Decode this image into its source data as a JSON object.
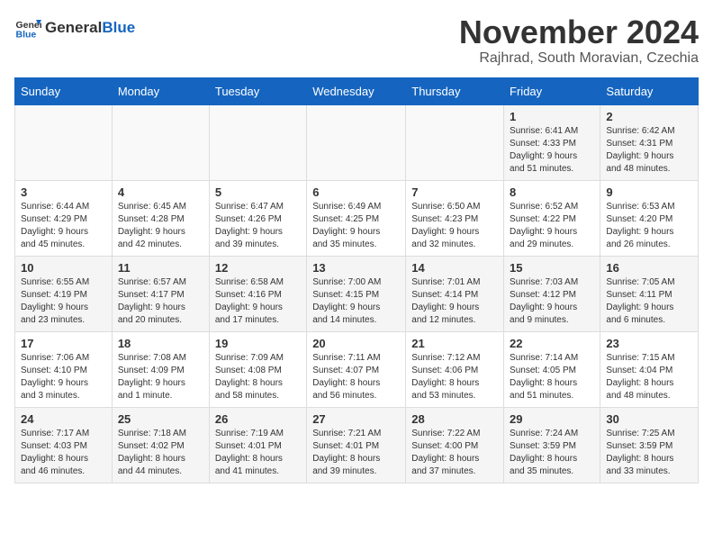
{
  "logo": {
    "general": "General",
    "blue": "Blue"
  },
  "header": {
    "month": "November 2024",
    "location": "Rajhrad, South Moravian, Czechia"
  },
  "weekdays": [
    "Sunday",
    "Monday",
    "Tuesday",
    "Wednesday",
    "Thursday",
    "Friday",
    "Saturday"
  ],
  "weeks": [
    [
      {
        "day": "",
        "info": ""
      },
      {
        "day": "",
        "info": ""
      },
      {
        "day": "",
        "info": ""
      },
      {
        "day": "",
        "info": ""
      },
      {
        "day": "",
        "info": ""
      },
      {
        "day": "1",
        "info": "Sunrise: 6:41 AM\nSunset: 4:33 PM\nDaylight: 9 hours\nand 51 minutes."
      },
      {
        "day": "2",
        "info": "Sunrise: 6:42 AM\nSunset: 4:31 PM\nDaylight: 9 hours\nand 48 minutes."
      }
    ],
    [
      {
        "day": "3",
        "info": "Sunrise: 6:44 AM\nSunset: 4:29 PM\nDaylight: 9 hours\nand 45 minutes."
      },
      {
        "day": "4",
        "info": "Sunrise: 6:45 AM\nSunset: 4:28 PM\nDaylight: 9 hours\nand 42 minutes."
      },
      {
        "day": "5",
        "info": "Sunrise: 6:47 AM\nSunset: 4:26 PM\nDaylight: 9 hours\nand 39 minutes."
      },
      {
        "day": "6",
        "info": "Sunrise: 6:49 AM\nSunset: 4:25 PM\nDaylight: 9 hours\nand 35 minutes."
      },
      {
        "day": "7",
        "info": "Sunrise: 6:50 AM\nSunset: 4:23 PM\nDaylight: 9 hours\nand 32 minutes."
      },
      {
        "day": "8",
        "info": "Sunrise: 6:52 AM\nSunset: 4:22 PM\nDaylight: 9 hours\nand 29 minutes."
      },
      {
        "day": "9",
        "info": "Sunrise: 6:53 AM\nSunset: 4:20 PM\nDaylight: 9 hours\nand 26 minutes."
      }
    ],
    [
      {
        "day": "10",
        "info": "Sunrise: 6:55 AM\nSunset: 4:19 PM\nDaylight: 9 hours\nand 23 minutes."
      },
      {
        "day": "11",
        "info": "Sunrise: 6:57 AM\nSunset: 4:17 PM\nDaylight: 9 hours\nand 20 minutes."
      },
      {
        "day": "12",
        "info": "Sunrise: 6:58 AM\nSunset: 4:16 PM\nDaylight: 9 hours\nand 17 minutes."
      },
      {
        "day": "13",
        "info": "Sunrise: 7:00 AM\nSunset: 4:15 PM\nDaylight: 9 hours\nand 14 minutes."
      },
      {
        "day": "14",
        "info": "Sunrise: 7:01 AM\nSunset: 4:14 PM\nDaylight: 9 hours\nand 12 minutes."
      },
      {
        "day": "15",
        "info": "Sunrise: 7:03 AM\nSunset: 4:12 PM\nDaylight: 9 hours\nand 9 minutes."
      },
      {
        "day": "16",
        "info": "Sunrise: 7:05 AM\nSunset: 4:11 PM\nDaylight: 9 hours\nand 6 minutes."
      }
    ],
    [
      {
        "day": "17",
        "info": "Sunrise: 7:06 AM\nSunset: 4:10 PM\nDaylight: 9 hours\nand 3 minutes."
      },
      {
        "day": "18",
        "info": "Sunrise: 7:08 AM\nSunset: 4:09 PM\nDaylight: 9 hours\nand 1 minute."
      },
      {
        "day": "19",
        "info": "Sunrise: 7:09 AM\nSunset: 4:08 PM\nDaylight: 8 hours\nand 58 minutes."
      },
      {
        "day": "20",
        "info": "Sunrise: 7:11 AM\nSunset: 4:07 PM\nDaylight: 8 hours\nand 56 minutes."
      },
      {
        "day": "21",
        "info": "Sunrise: 7:12 AM\nSunset: 4:06 PM\nDaylight: 8 hours\nand 53 minutes."
      },
      {
        "day": "22",
        "info": "Sunrise: 7:14 AM\nSunset: 4:05 PM\nDaylight: 8 hours\nand 51 minutes."
      },
      {
        "day": "23",
        "info": "Sunrise: 7:15 AM\nSunset: 4:04 PM\nDaylight: 8 hours\nand 48 minutes."
      }
    ],
    [
      {
        "day": "24",
        "info": "Sunrise: 7:17 AM\nSunset: 4:03 PM\nDaylight: 8 hours\nand 46 minutes."
      },
      {
        "day": "25",
        "info": "Sunrise: 7:18 AM\nSunset: 4:02 PM\nDaylight: 8 hours\nand 44 minutes."
      },
      {
        "day": "26",
        "info": "Sunrise: 7:19 AM\nSunset: 4:01 PM\nDaylight: 8 hours\nand 41 minutes."
      },
      {
        "day": "27",
        "info": "Sunrise: 7:21 AM\nSunset: 4:01 PM\nDaylight: 8 hours\nand 39 minutes."
      },
      {
        "day": "28",
        "info": "Sunrise: 7:22 AM\nSunset: 4:00 PM\nDaylight: 8 hours\nand 37 minutes."
      },
      {
        "day": "29",
        "info": "Sunrise: 7:24 AM\nSunset: 3:59 PM\nDaylight: 8 hours\nand 35 minutes."
      },
      {
        "day": "30",
        "info": "Sunrise: 7:25 AM\nSunset: 3:59 PM\nDaylight: 8 hours\nand 33 minutes."
      }
    ]
  ]
}
